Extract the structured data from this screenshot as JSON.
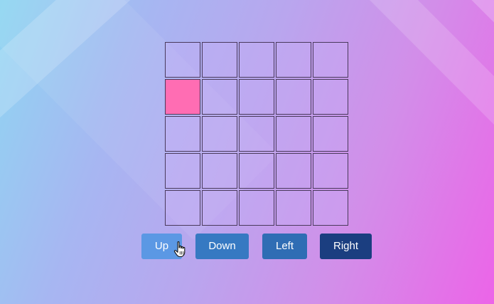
{
  "board": {
    "rows": 5,
    "cols": 5,
    "active_cell": {
      "row": 1,
      "col": 0
    },
    "cell_color": "#c8aff5",
    "active_color": "#ff6db3"
  },
  "controls": {
    "up_label": "Up",
    "down_label": "Down",
    "left_label": "Left",
    "right_label": "Right"
  },
  "colors": {
    "up": "#5b98e4",
    "down": "#3679c2",
    "left": "#2f6db4",
    "right": "#1b3e80"
  },
  "cursor": {
    "icon": "hand-pointer-icon"
  }
}
